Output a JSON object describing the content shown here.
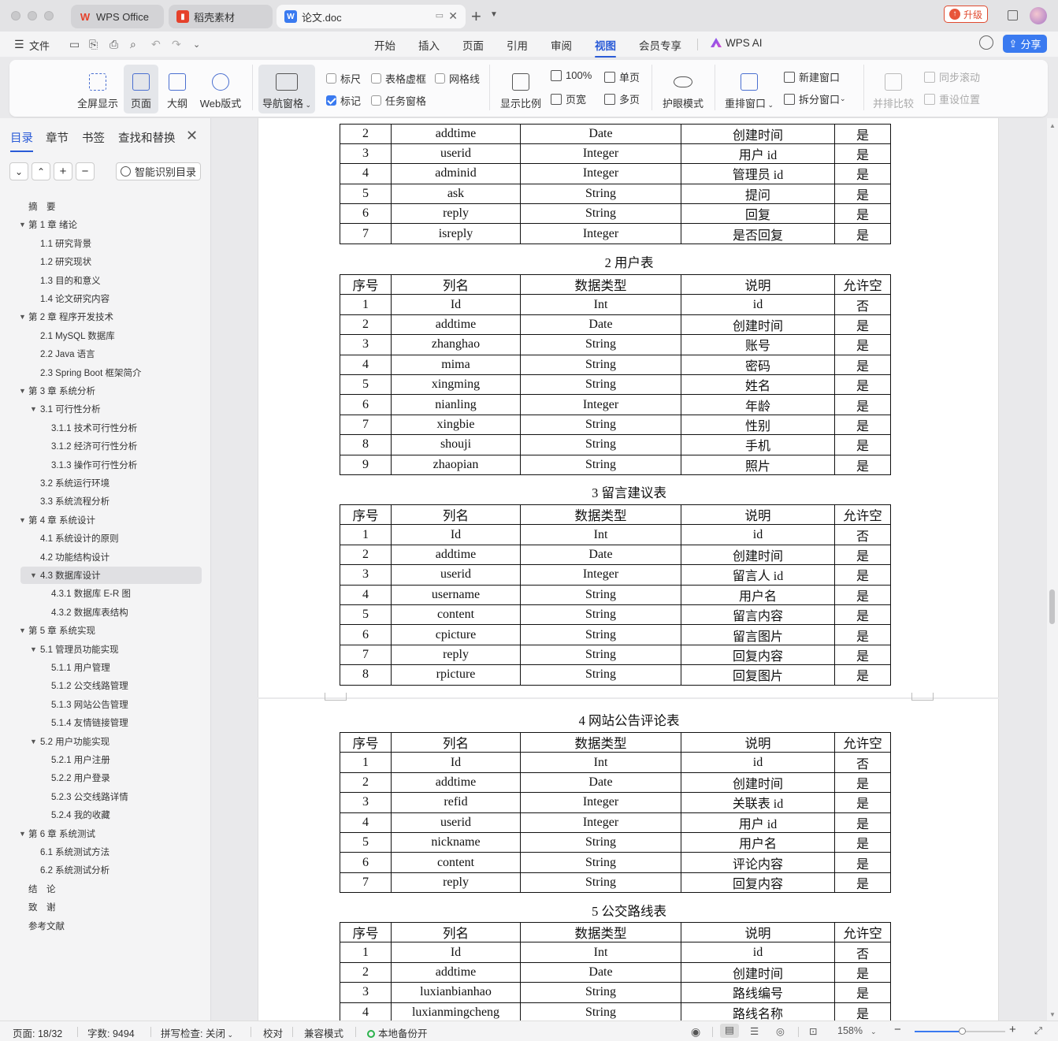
{
  "titlebar": {
    "tabs": [
      {
        "label": "WPS Office",
        "icon": "wps-logo-icon",
        "color": "#e5412b"
      },
      {
        "label": "稻壳素材",
        "icon": "docer-icon",
        "color": "#e5412b"
      },
      {
        "label": "论文.doc",
        "icon": "word-doc-icon",
        "color": "#3a7af0"
      }
    ],
    "new_tab": "+",
    "upgrade": "升级"
  },
  "menubar": {
    "file": "文件",
    "tabs": [
      "开始",
      "插入",
      "页面",
      "引用",
      "审阅",
      "视图",
      "会员专享"
    ],
    "active_tab": "视图",
    "wps_ai": "WPS AI",
    "share": "分享"
  },
  "ribbon": {
    "fullscreen": "全屏显示",
    "page": "页面",
    "outline": "大纲",
    "web": "Web版式",
    "nav_pane": "导航窗格",
    "ruler": "标尺",
    "table_dotted": "表格虚框",
    "gridlines": "网格线",
    "mark": "标记",
    "task_pane": "任务窗格",
    "display_ratio": "显示比例",
    "zoom100": "100%",
    "page_width": "页宽",
    "single_page": "单页",
    "multi_page": "多页",
    "eye_mode": "护眼模式",
    "rearrange": "重排窗口",
    "new_window": "新建窗口",
    "split_window": "拆分窗口",
    "side_by_side": "并排比较",
    "sync_scroll": "同步滚动",
    "reset_position": "重设位置"
  },
  "sidebar": {
    "tabs": [
      "目录",
      "章节",
      "书签",
      "查找和替换"
    ],
    "smart_toc": "智能识别目录",
    "toc": [
      {
        "label": "摘　要",
        "level": 0,
        "arrow": false
      },
      {
        "label": "第 1 章  绪论",
        "level": 0,
        "arrow": true
      },
      {
        "label": "1.1  研究背景",
        "level": 1,
        "arrow": false
      },
      {
        "label": "1.2  研究现状",
        "level": 1,
        "arrow": false
      },
      {
        "label": "1.3  目的和意义",
        "level": 1,
        "arrow": false
      },
      {
        "label": "1.4  论文研究内容",
        "level": 1,
        "arrow": false
      },
      {
        "label": "第 2 章  程序开发技术",
        "level": 0,
        "arrow": true
      },
      {
        "label": "2.1 MySQL 数据库",
        "level": 1,
        "arrow": false
      },
      {
        "label": "2.2 Java 语言",
        "level": 1,
        "arrow": false
      },
      {
        "label": "2.3 Spring Boot 框架简介",
        "level": 1,
        "arrow": false
      },
      {
        "label": "第 3 章  系统分析",
        "level": 0,
        "arrow": true
      },
      {
        "label": "3.1 可行性分析",
        "level": 1,
        "arrow": true
      },
      {
        "label": "3.1.1 技术可行性分析",
        "level": 2,
        "arrow": false
      },
      {
        "label": "3.1.2 经济可行性分析",
        "level": 2,
        "arrow": false
      },
      {
        "label": "3.1.3 操作可行性分析",
        "level": 2,
        "arrow": false
      },
      {
        "label": "3.2 系统运行环境",
        "level": 1,
        "arrow": false
      },
      {
        "label": "3.3 系统流程分析",
        "level": 1,
        "arrow": false
      },
      {
        "label": "第 4 章  系统设计",
        "level": 0,
        "arrow": true
      },
      {
        "label": "4.1  系统设计的原则",
        "level": 1,
        "arrow": false
      },
      {
        "label": "4.2  功能结构设计",
        "level": 1,
        "arrow": false
      },
      {
        "label": "4.3  数据库设计",
        "level": 1,
        "arrow": true,
        "selected": true
      },
      {
        "label": "4.3.1  数据库 E-R 图",
        "level": 2,
        "arrow": false
      },
      {
        "label": "4.3.2  数据库表结构",
        "level": 2,
        "arrow": false
      },
      {
        "label": "第 5 章  系统实现",
        "level": 0,
        "arrow": true
      },
      {
        "label": "5.1 管理员功能实现",
        "level": 1,
        "arrow": true
      },
      {
        "label": "5.1.1  用户管理",
        "level": 2,
        "arrow": false
      },
      {
        "label": "5.1.2  公交线路管理",
        "level": 2,
        "arrow": false
      },
      {
        "label": "5.1.3  网站公告管理",
        "level": 2,
        "arrow": false
      },
      {
        "label": "5.1.4  友情链接管理",
        "level": 2,
        "arrow": false
      },
      {
        "label": "5.2  用户功能实现",
        "level": 1,
        "arrow": true
      },
      {
        "label": "5.2.1  用户注册",
        "level": 2,
        "arrow": false
      },
      {
        "label": "5.2.2  用户登录",
        "level": 2,
        "arrow": false
      },
      {
        "label": "5.2.3  公交线路详情",
        "level": 2,
        "arrow": false
      },
      {
        "label": "5.2.4  我的收藏",
        "level": 2,
        "arrow": false
      },
      {
        "label": "第 6 章  系统测试",
        "level": 0,
        "arrow": true
      },
      {
        "label": "6.1 系统测试方法",
        "level": 1,
        "arrow": false
      },
      {
        "label": "6.2  系统测试分析",
        "level": 1,
        "arrow": false
      },
      {
        "label": "结　论",
        "level": 0,
        "arrow": false
      },
      {
        "label": "致　谢",
        "level": 0,
        "arrow": false
      },
      {
        "label": "参考文献",
        "level": 0,
        "arrow": false
      }
    ]
  },
  "document": {
    "header_row": [
      "序号",
      "列名",
      "数据类型",
      "说明",
      "允许空"
    ],
    "table0_rows": [
      [
        "2",
        "addtime",
        "Date",
        "创建时间",
        "是"
      ],
      [
        "3",
        "userid",
        "Integer",
        "用户 id",
        "是"
      ],
      [
        "4",
        "adminid",
        "Integer",
        "管理员 id",
        "是"
      ],
      [
        "5",
        "ask",
        "String",
        "提问",
        "是"
      ],
      [
        "6",
        "reply",
        "String",
        "回复",
        "是"
      ],
      [
        "7",
        "isreply",
        "Integer",
        "是否回复",
        "是"
      ]
    ],
    "tables": [
      {
        "caption": "2 用户表",
        "rows": [
          [
            "1",
            "Id",
            "Int",
            "id",
            "否"
          ],
          [
            "2",
            "addtime",
            "Date",
            "创建时间",
            "是"
          ],
          [
            "3",
            "zhanghao",
            "String",
            "账号",
            "是"
          ],
          [
            "4",
            "mima",
            "String",
            "密码",
            "是"
          ],
          [
            "5",
            "xingming",
            "String",
            "姓名",
            "是"
          ],
          [
            "6",
            "nianling",
            "Integer",
            "年龄",
            "是"
          ],
          [
            "7",
            "xingbie",
            "String",
            "性别",
            "是"
          ],
          [
            "8",
            "shouji",
            "String",
            "手机",
            "是"
          ],
          [
            "9",
            "zhaopian",
            "String",
            "照片",
            "是"
          ]
        ]
      },
      {
        "caption": "3 留言建议表",
        "rows": [
          [
            "1",
            "Id",
            "Int",
            "id",
            "否"
          ],
          [
            "2",
            "addtime",
            "Date",
            "创建时间",
            "是"
          ],
          [
            "3",
            "userid",
            "Integer",
            "留言人 id",
            "是"
          ],
          [
            "4",
            "username",
            "String",
            "用户名",
            "是"
          ],
          [
            "5",
            "content",
            "String",
            "留言内容",
            "是"
          ],
          [
            "6",
            "cpicture",
            "String",
            "留言图片",
            "是"
          ],
          [
            "7",
            "reply",
            "String",
            "回复内容",
            "是"
          ],
          [
            "8",
            "rpicture",
            "String",
            "回复图片",
            "是"
          ]
        ]
      },
      {
        "caption": "4 网站公告评论表",
        "rows": [
          [
            "1",
            "Id",
            "Int",
            "id",
            "否"
          ],
          [
            "2",
            "addtime",
            "Date",
            "创建时间",
            "是"
          ],
          [
            "3",
            "refid",
            "Integer",
            "关联表 id",
            "是"
          ],
          [
            "4",
            "userid",
            "Integer",
            "用户 id",
            "是"
          ],
          [
            "5",
            "nickname",
            "String",
            "用户名",
            "是"
          ],
          [
            "6",
            "content",
            "String",
            "评论内容",
            "是"
          ],
          [
            "7",
            "reply",
            "String",
            "回复内容",
            "是"
          ]
        ]
      },
      {
        "caption": "5 公交路线表",
        "rows": [
          [
            "1",
            "Id",
            "Int",
            "id",
            "否"
          ],
          [
            "2",
            "addtime",
            "Date",
            "创建时间",
            "是"
          ],
          [
            "3",
            "luxianbianhao",
            "String",
            "路线编号",
            "是"
          ],
          [
            "4",
            "luxianmingcheng",
            "String",
            "路线名称",
            "是"
          ]
        ]
      }
    ]
  },
  "statusbar": {
    "page": "页面: 18/32",
    "words": "字数: 9494",
    "spell": "拼写检查: 关闭",
    "proof": "校对",
    "compat": "兼容模式",
    "backup": "本地备份开",
    "zoom": "158%",
    "zoom_level": 0.52
  },
  "colors": {
    "accent": "#2a5bd7",
    "share_button": "#3a7af0",
    "upgrade": "#e04a2f"
  }
}
